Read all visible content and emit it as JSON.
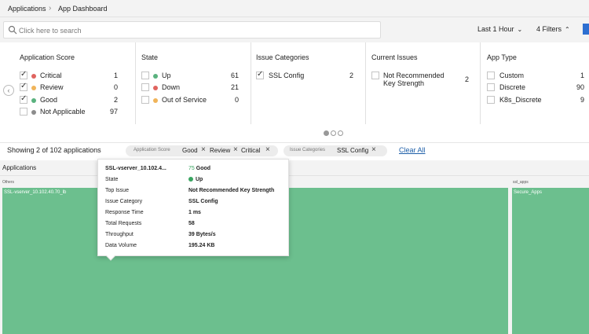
{
  "breadcrumb": {
    "root": "Applications",
    "separator": "›",
    "current": "App Dashboard"
  },
  "search": {
    "placeholder": "Click here to search",
    "value": ""
  },
  "toolbar": {
    "time_range": "Last 1 Hour",
    "filters_label": "4 Filters"
  },
  "filter_panel": {
    "application_score": {
      "title": "Application Score",
      "items": [
        {
          "label": "Critical",
          "count": "1",
          "checked": true,
          "color": "#e0645f"
        },
        {
          "label": "Review",
          "count": "0",
          "checked": true,
          "color": "#f0b45a"
        },
        {
          "label": "Good",
          "count": "2",
          "checked": true,
          "color": "#5ab27e"
        },
        {
          "label": "Not Applicable",
          "count": "97",
          "checked": false,
          "color": "#8c8c8c"
        }
      ]
    },
    "state": {
      "title": "State",
      "items": [
        {
          "label": "Up",
          "count": "61",
          "checked": false,
          "color": "#5ab27e"
        },
        {
          "label": "Down",
          "count": "21",
          "checked": false,
          "color": "#e0645f"
        },
        {
          "label": "Out of Service",
          "count": "0",
          "checked": false,
          "color": "#f0b45a"
        }
      ]
    },
    "issue_categories": {
      "title": "Issue Categories",
      "items": [
        {
          "label": "SSL Config",
          "count": "2",
          "checked": true
        }
      ]
    },
    "current_issues": {
      "title": "Current Issues",
      "items": [
        {
          "label_line1": "Not Recommended",
          "label_line2": "Key Strength",
          "count": "2",
          "checked": false
        }
      ]
    },
    "app_type": {
      "title": "App Type",
      "items": [
        {
          "label": "Custom",
          "count": "1",
          "checked": false
        },
        {
          "label": "Discrete",
          "count": "90",
          "checked": false
        },
        {
          "label": "K8s_Discrete",
          "count": "9",
          "checked": false
        }
      ]
    }
  },
  "filter_bar": {
    "showing": "Showing 2 of 102 applications",
    "chips": [
      {
        "key": "Application Score",
        "values": [
          "Good",
          "Review",
          "Critical"
        ]
      },
      {
        "key": "Issue Categories",
        "values": [
          "SSL Config"
        ]
      }
    ],
    "clear_all": "Clear All"
  },
  "applications": {
    "title": "Applications",
    "groups": [
      {
        "label": "Others",
        "tiles": [
          "SSL-vserver_10.102.40.70_lb"
        ]
      },
      {
        "label": "ssl_apps",
        "tiles": [
          "Secure_Apps"
        ]
      }
    ]
  },
  "tooltip": {
    "name": "SSL-vserver_10.102.4...",
    "score_value": "75",
    "score_label": "Good",
    "rows": [
      {
        "key": "State",
        "value": "Up"
      },
      {
        "key": "Top Issue",
        "value": "Not Recommended Key Strength"
      },
      {
        "key": "Issue Category",
        "value": "SSL Config"
      },
      {
        "key": "Response Time",
        "value": "1 ms"
      },
      {
        "key": "Total Requests",
        "value": "58"
      },
      {
        "key": "Throughput",
        "value": "39 Bytes/s"
      },
      {
        "key": "Data Volume",
        "value": "195.24 KB"
      }
    ]
  },
  "colors": {
    "tile": "#6cbf8e",
    "link": "#1c5ea8",
    "good": "#3aa561"
  }
}
